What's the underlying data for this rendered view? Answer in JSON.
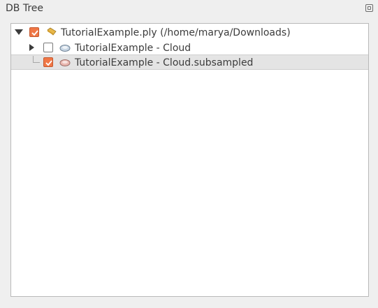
{
  "panel": {
    "title": "DB Tree"
  },
  "tree": {
    "items": [
      {
        "label": "TutorialExample.ply (/home/marya/Downloads)",
        "checked": true,
        "expanded": true,
        "icon": "folder-icon"
      },
      {
        "label": "TutorialExample - Cloud",
        "checked": false,
        "expanded": false,
        "icon": "cloud-icon"
      },
      {
        "label": "TutorialExample - Cloud.subsampled",
        "checked": true,
        "selected": true,
        "icon": "cloud-icon"
      }
    ]
  },
  "colors": {
    "checkbox_checked": "#f07746",
    "selection": "#e4e4e4",
    "folder": "#e8b84a",
    "cloud_unselected": "#9fb3c8",
    "cloud_selected": "#e0a0a0"
  }
}
